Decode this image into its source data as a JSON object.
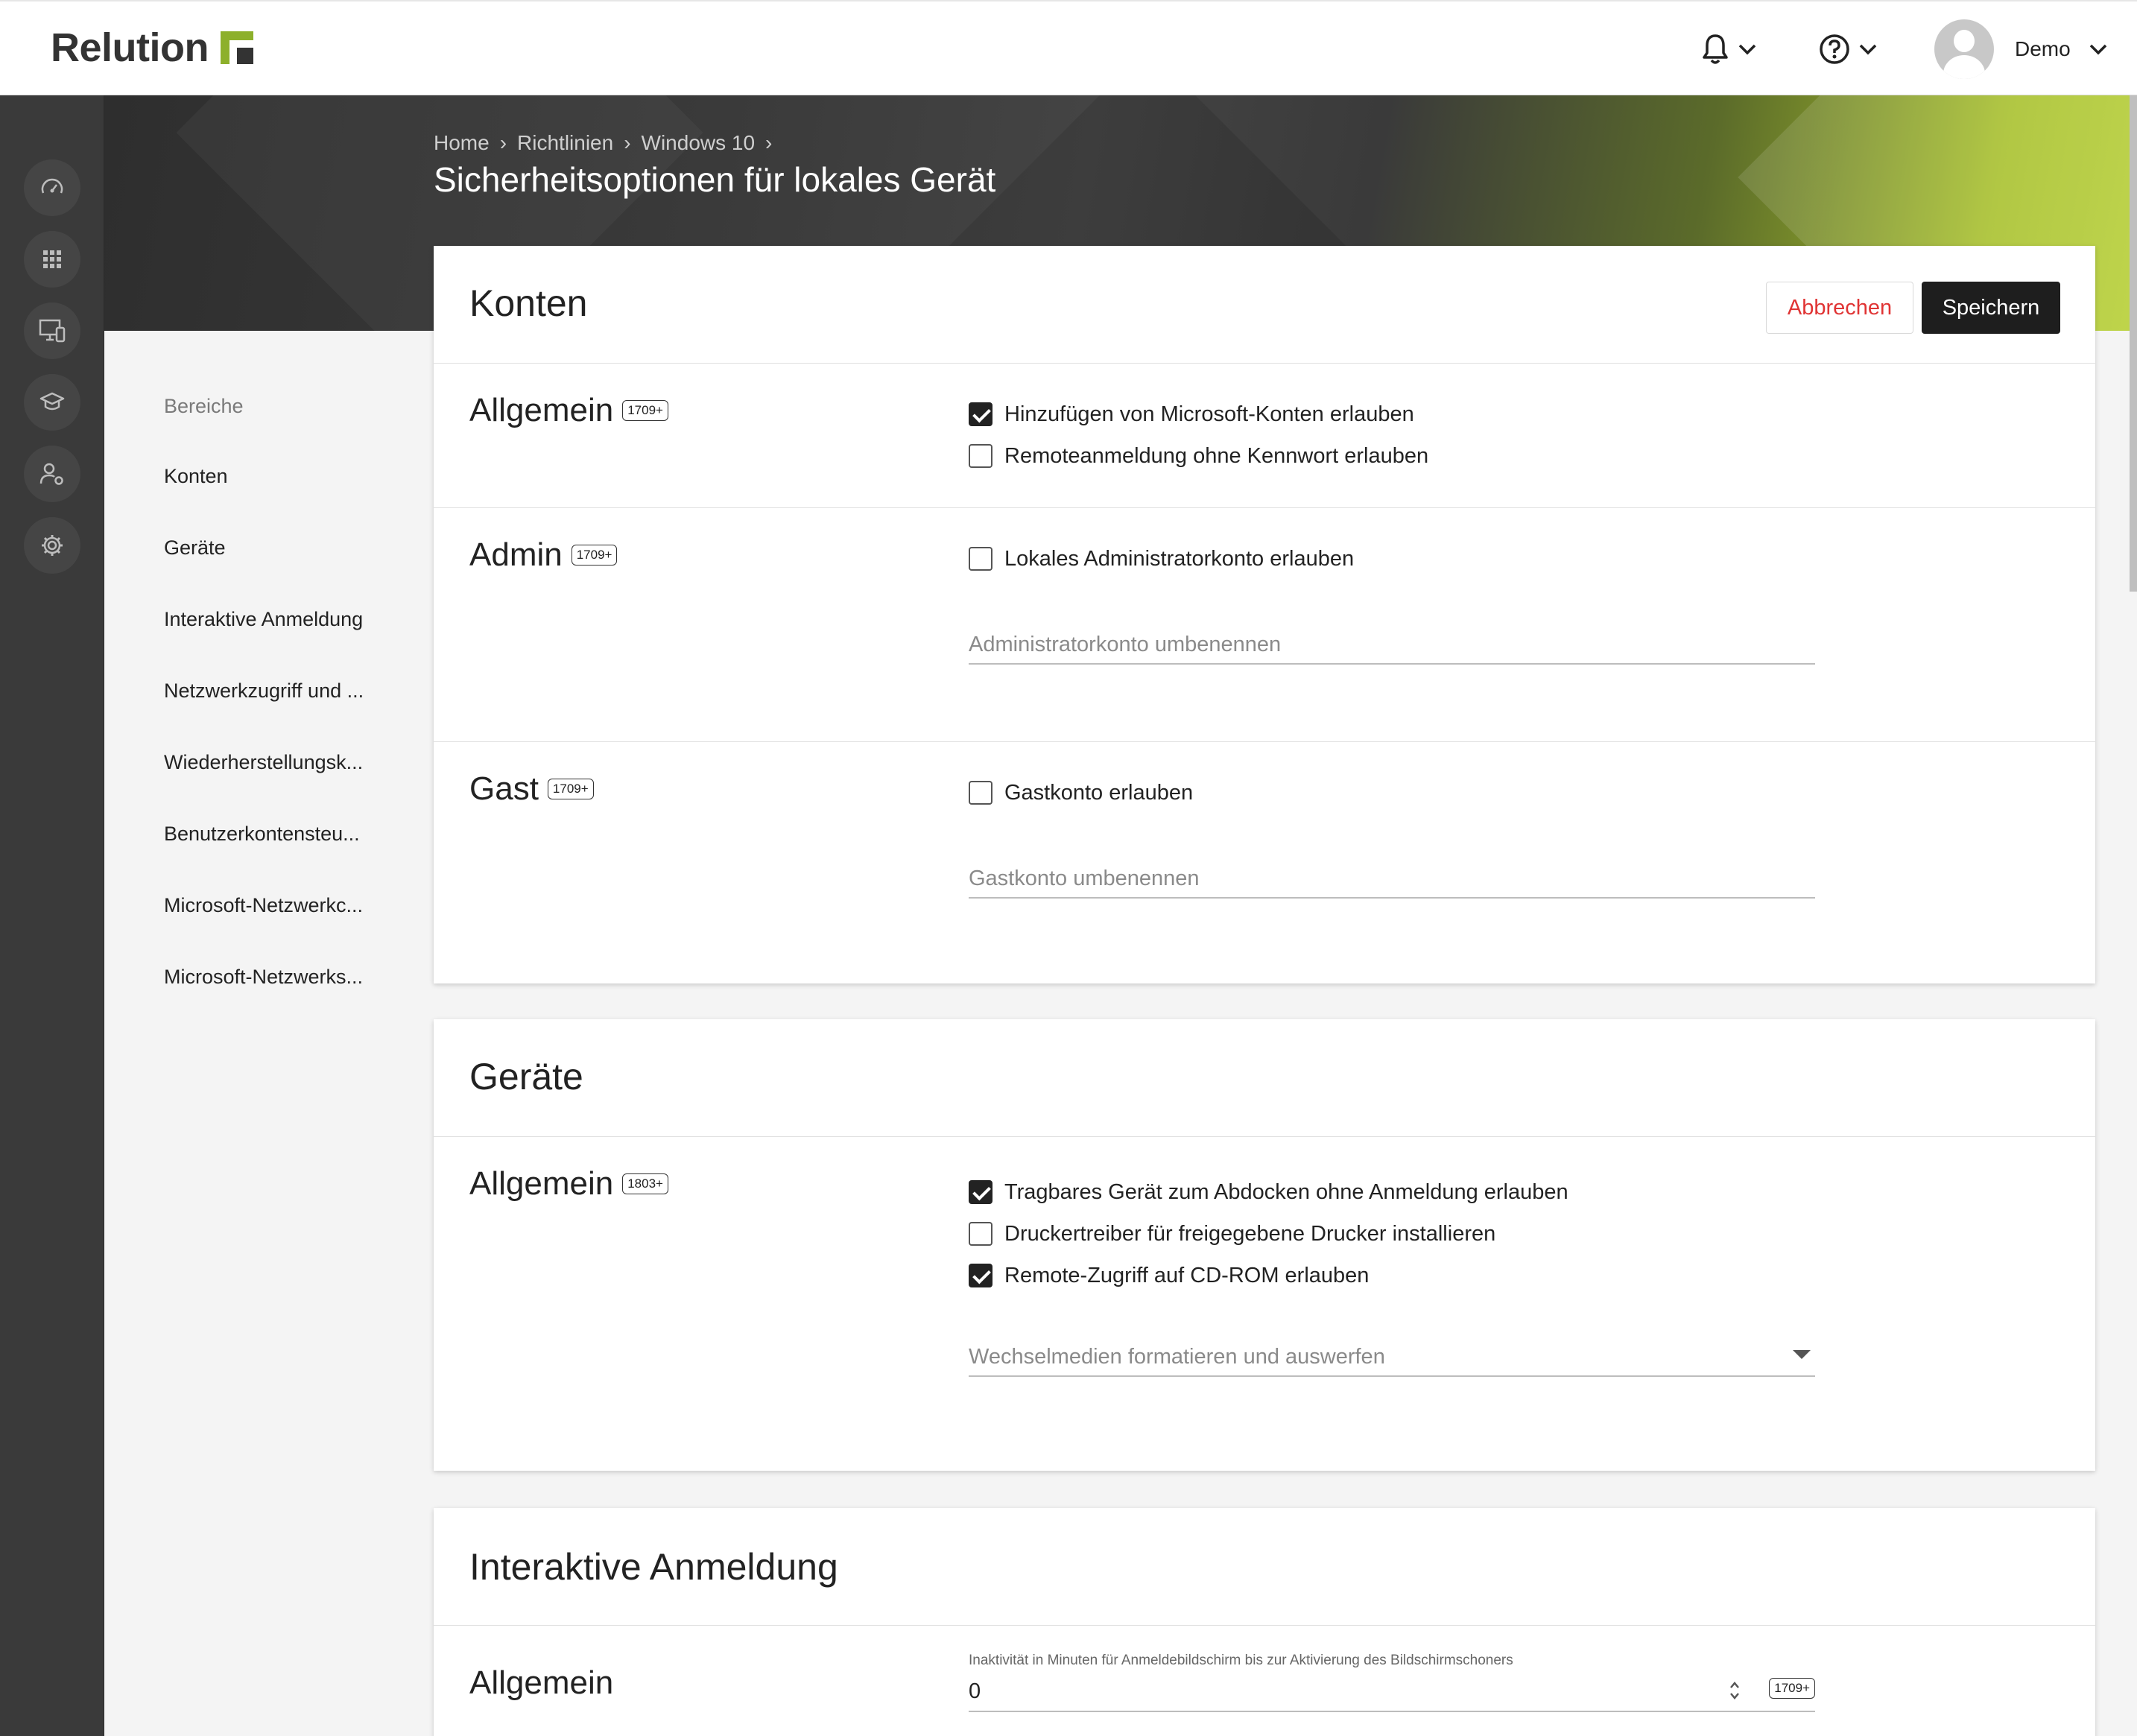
{
  "app": {
    "logo_text": "Relution"
  },
  "topbar": {
    "user_name": "Demo"
  },
  "breadcrumb": [
    "Home",
    "Richtlinien",
    "Windows 10"
  ],
  "page_title": "Sicherheitsoptionen für lokales Gerät",
  "section_nav": {
    "heading": "Bereiche",
    "items": [
      "Konten",
      "Geräte",
      "Interaktive Anmeldung",
      "Netzwerkzugriff und ...",
      "Wiederherstellungsk...",
      "Benutzerkontensteu...",
      "Microsoft-Netzwerkc...",
      "Microsoft-Netzwerks..."
    ]
  },
  "actions": {
    "cancel_label": "Abbrechen",
    "save_label": "Speichern"
  },
  "konten": {
    "title": "Konten",
    "allgemein": {
      "title": "Allgemein",
      "badge": "1709+",
      "options": [
        {
          "label": "Hinzufügen von Microsoft-Konten erlauben",
          "checked": true
        },
        {
          "label": "Remoteanmeldung ohne Kennwort erlauben",
          "checked": false
        }
      ]
    },
    "admin": {
      "title": "Admin",
      "badge": "1709+",
      "option": {
        "label": "Lokales Administratorkonto erlauben",
        "checked": false
      },
      "rename_placeholder": "Administratorkonto umbenennen"
    },
    "gast": {
      "title": "Gast",
      "badge": "1709+",
      "option": {
        "label": "Gastkonto erlauben",
        "checked": false
      },
      "rename_placeholder": "Gastkonto umbenennen"
    }
  },
  "geraete": {
    "title": "Geräte",
    "allgemein": {
      "title": "Allgemein",
      "badge": "1803+",
      "options": [
        {
          "label": "Tragbares Gerät zum Abdocken ohne Anmeldung erlauben",
          "checked": true
        },
        {
          "label": "Druckertreiber für freigegebene Drucker installieren",
          "checked": false
        },
        {
          "label": "Remote-Zugriff auf CD-ROM erlauben",
          "checked": true
        }
      ],
      "select_placeholder": "Wechselmedien formatieren und auswerfen"
    }
  },
  "interaktive_anmeldung": {
    "title": "Interaktive Anmeldung",
    "allgemein": {
      "title": "Allgemein",
      "inactivity_label": "Inaktivität in Minuten für Anmeldebildschirm bis zur Aktivierung des Bildschirmschoners",
      "inactivity_value": "0",
      "badge": "1709+"
    }
  },
  "colors": {
    "accent": "#8db02b",
    "danger": "#e03434",
    "dark": "#1e1e1e"
  }
}
